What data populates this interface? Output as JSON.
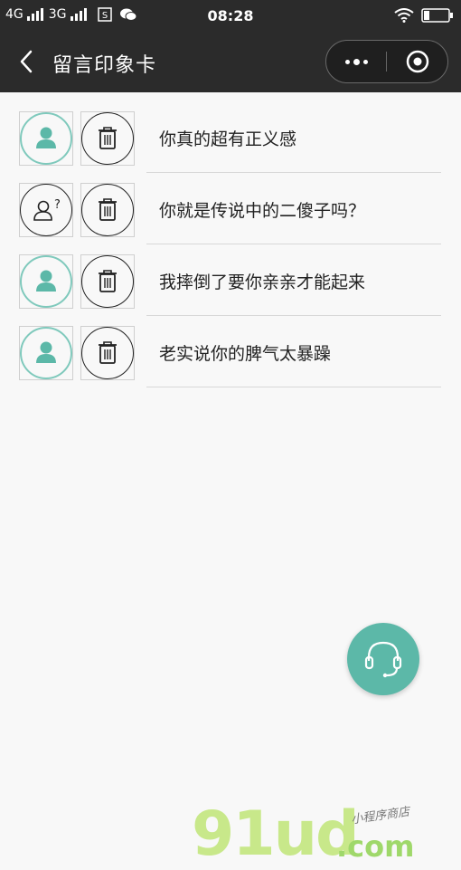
{
  "statusbar": {
    "carrier1": "4G",
    "carrier2": "3G",
    "time": "08:28",
    "icons": [
      "signal-icon",
      "sim-s-icon",
      "wechat-icon",
      "wifi-icon",
      "battery-icon"
    ]
  },
  "navbar": {
    "title": "留言印象卡",
    "back_icon": "chevron-left-icon",
    "more_icon": "more-dots-icon",
    "close_icon": "target-close-icon"
  },
  "items": [
    {
      "message": "你真的超有正义感",
      "avatar": "person-teal"
    },
    {
      "message": "你就是传说中的二傻子吗？",
      "avatar": "person-question-outline"
    },
    {
      "message": "我摔倒了要你亲亲才能起来",
      "avatar": "person-teal"
    },
    {
      "message": "老实说你的脾气太暴躁",
      "avatar": "person-teal"
    }
  ],
  "fab": {
    "icon": "headset-icon"
  },
  "watermark": {
    "big": "91ud",
    "com": ".com",
    "small": "小程序商店"
  },
  "colors": {
    "bar": "#2b2b2b",
    "accent": "#5cb8a8",
    "background": "#f8f8f8"
  }
}
